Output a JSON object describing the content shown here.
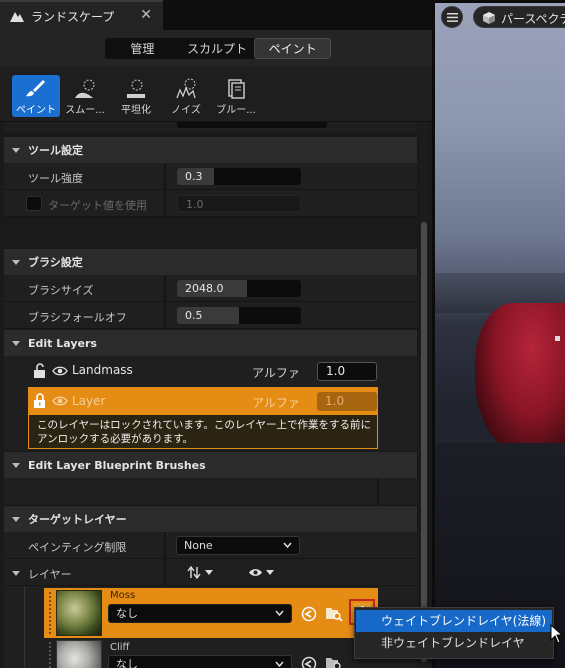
{
  "tab": {
    "title": "ランドスケープ",
    "close": "✕"
  },
  "modes": [
    {
      "label": "管理",
      "active": false
    },
    {
      "label": "スカルプト",
      "active": false
    },
    {
      "label": "ペイント",
      "active": true
    }
  ],
  "tools": [
    {
      "label": "ペイント",
      "icon": "paint-brush-icon",
      "active": true
    },
    {
      "label": "スムー...",
      "icon": "smooth-icon",
      "active": false
    },
    {
      "label": "平坦化",
      "icon": "flatten-icon",
      "active": false
    },
    {
      "label": "ノイズ",
      "icon": "noise-icon",
      "active": false
    },
    {
      "label": "ブルー...",
      "icon": "blueprint-icon",
      "active": false
    }
  ],
  "tool_settings": {
    "header": "ツール設定",
    "strength_label": "ツール強度",
    "strength_value": "0.3",
    "strength_fill": 0.3,
    "target_label": "ターゲット値を使用",
    "target_value": "1.0"
  },
  "brush_settings": {
    "header": "ブラシ設定",
    "size_label": "ブラシサイズ",
    "size_value": "2048.0",
    "falloff_label": "ブラシフォールオフ",
    "falloff_value": "0.5",
    "falloff_fill": 0.5
  },
  "edit_layers": {
    "header": "Edit Layers",
    "layers": [
      {
        "name": "Landmass",
        "alpha_label": "アルファ",
        "alpha": "1.0",
        "locked": true,
        "selected": false
      },
      {
        "name": "Layer",
        "alpha_label": "アルファ",
        "alpha": "1.0",
        "locked": true,
        "selected": true
      }
    ],
    "warning": "このレイヤーはロックされています。このレイヤー上で作業をする前にアンロックする必要があります。"
  },
  "blueprint_brushes": {
    "header": "Edit Layer Blueprint Brushes"
  },
  "target_layers": {
    "header": "ターゲットレイヤー",
    "paint_restriction_label": "ペインティング制限",
    "paint_restriction_value": "None",
    "layers_label": "レイヤー",
    "items": [
      {
        "name": "Moss",
        "dropdown": "なし",
        "selected": true
      },
      {
        "name": "Cliff",
        "dropdown": "なし",
        "selected": false
      }
    ]
  },
  "context_menu": {
    "items": [
      "ウェイトブレンドレイヤ(法線)",
      "非ウェイトブレンドレイヤ"
    ]
  },
  "viewport": {
    "perspective_label": "パースペクテ"
  },
  "colors": {
    "accent": "#1a6fd1",
    "locked_orange": "#e58c15",
    "highlight_red": "#c0271f"
  }
}
